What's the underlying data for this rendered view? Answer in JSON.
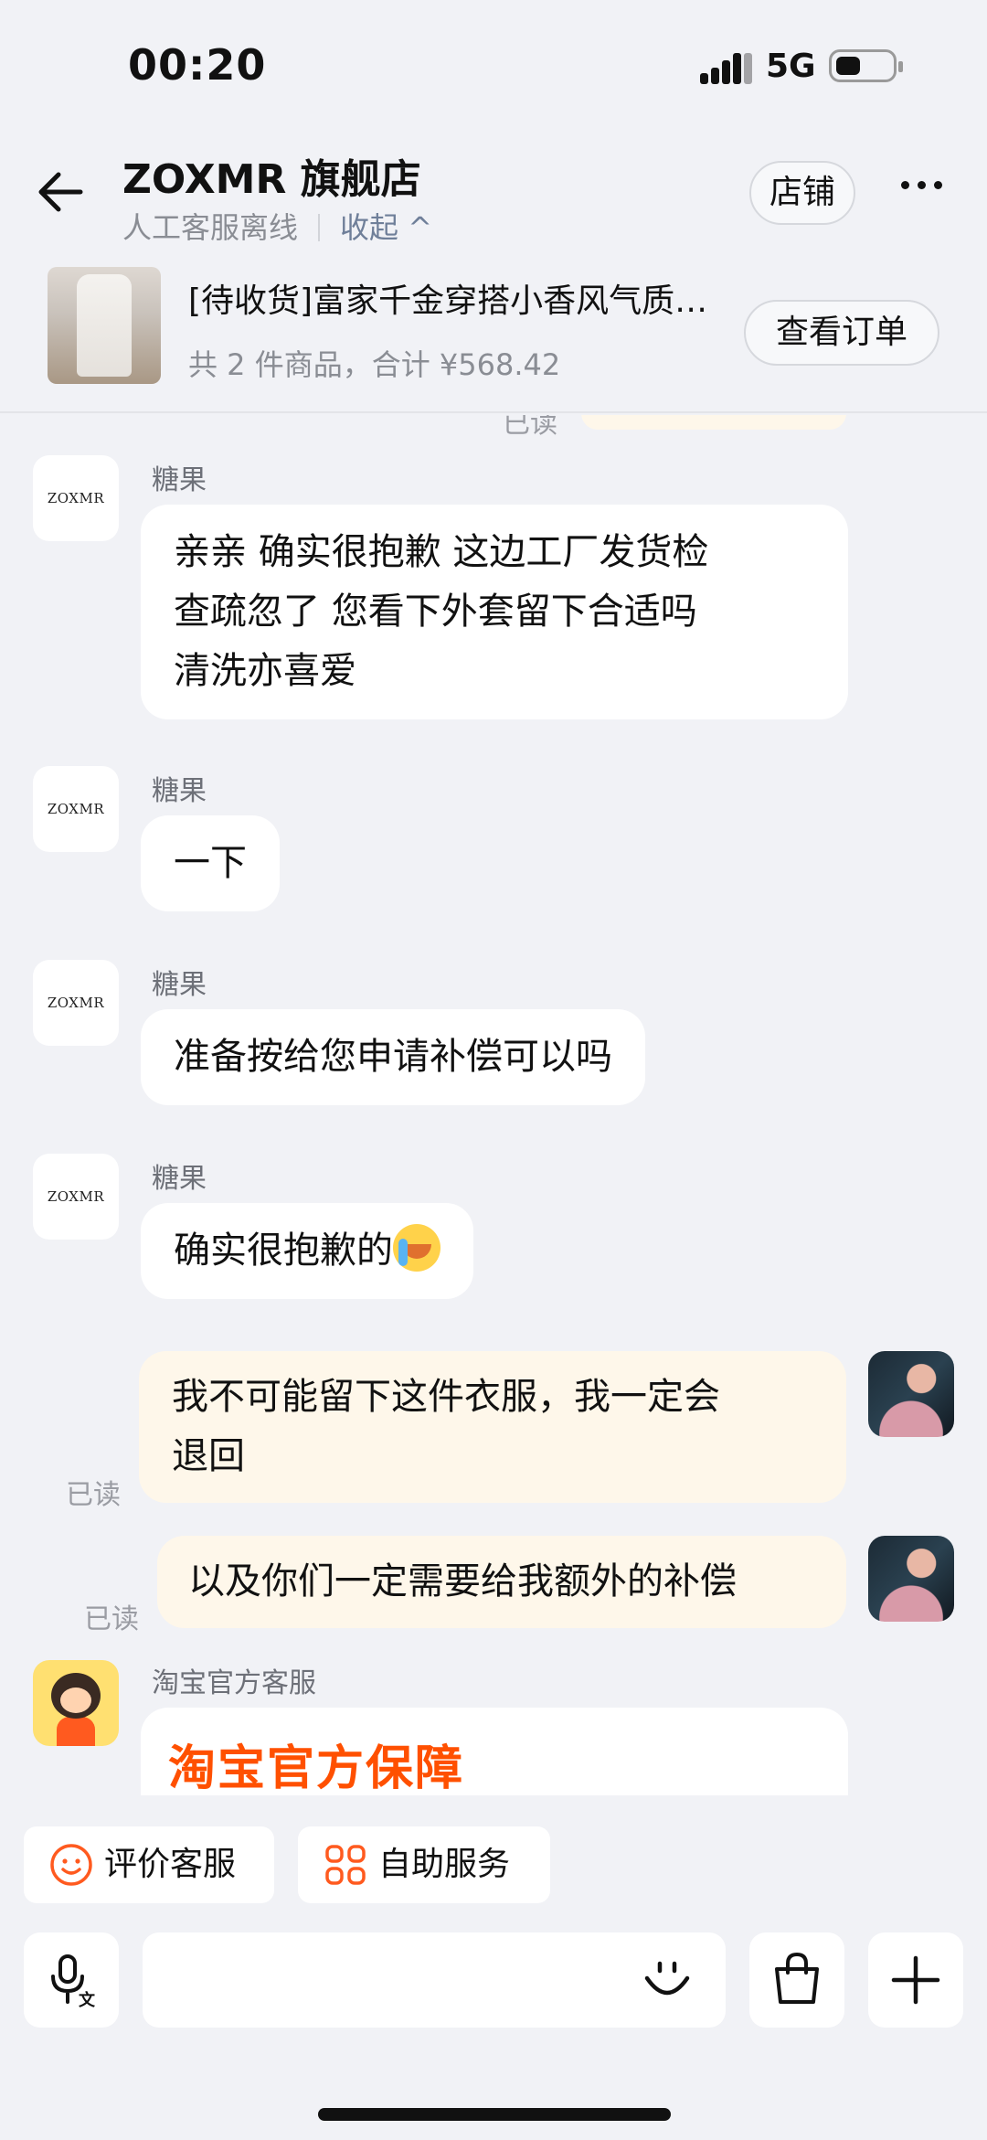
{
  "status_bar": {
    "time": "00:20",
    "network": "5G"
  },
  "header": {
    "store_name": "ZOXMR 旗舰店",
    "service_status": "人工客服离线",
    "collapse_label": "收起 ^",
    "shop_button": "店铺"
  },
  "order": {
    "title": "[待收货]富家千金穿搭小香风气质两件套",
    "summary": "共 2 件商品，合计 ¥568.42",
    "view_button": "查看订单"
  },
  "chat": {
    "ghost_read": "已读",
    "shop_avatar_text": "ZOXMR",
    "messages": [
      {
        "sender": "糖果",
        "lines": [
          "亲亲  确实很抱歉  这边工厂发货检",
          "查疏忽了  您看下外套留下合适吗",
          "清洗亦喜爱"
        ]
      },
      {
        "sender": "糖果",
        "lines": [
          "一下"
        ]
      },
      {
        "sender": "糖果",
        "lines": [
          "准备按给您申请补偿可以吗"
        ]
      },
      {
        "sender": "糖果",
        "lines": [
          "确实很抱歉的"
        ]
      },
      {
        "sender": "me",
        "read": "已读",
        "lines": [
          "我不可能留下这件衣服，我一定会",
          "退回"
        ]
      },
      {
        "sender": "me",
        "read": "已读",
        "lines": [
          "以及你们一定需要给我额外的补偿"
        ]
      }
    ],
    "official": {
      "sender": "淘宝官方客服",
      "banner": "淘宝官方保障"
    }
  },
  "quick_actions": [
    {
      "label": "评价客服",
      "icon": "smile-icon"
    },
    {
      "label": "自助服务",
      "icon": "grid-icon"
    }
  ],
  "input_bar": {
    "voice_icon": "voice-translate-icon",
    "emoji_icon": "emoji-icon",
    "bag_icon": "shopping-bag-icon",
    "plus_icon": "plus-icon"
  },
  "colors": {
    "background": "#f1f2f6",
    "my_bubble": "#fef7ea",
    "accent": "#ff5000"
  }
}
